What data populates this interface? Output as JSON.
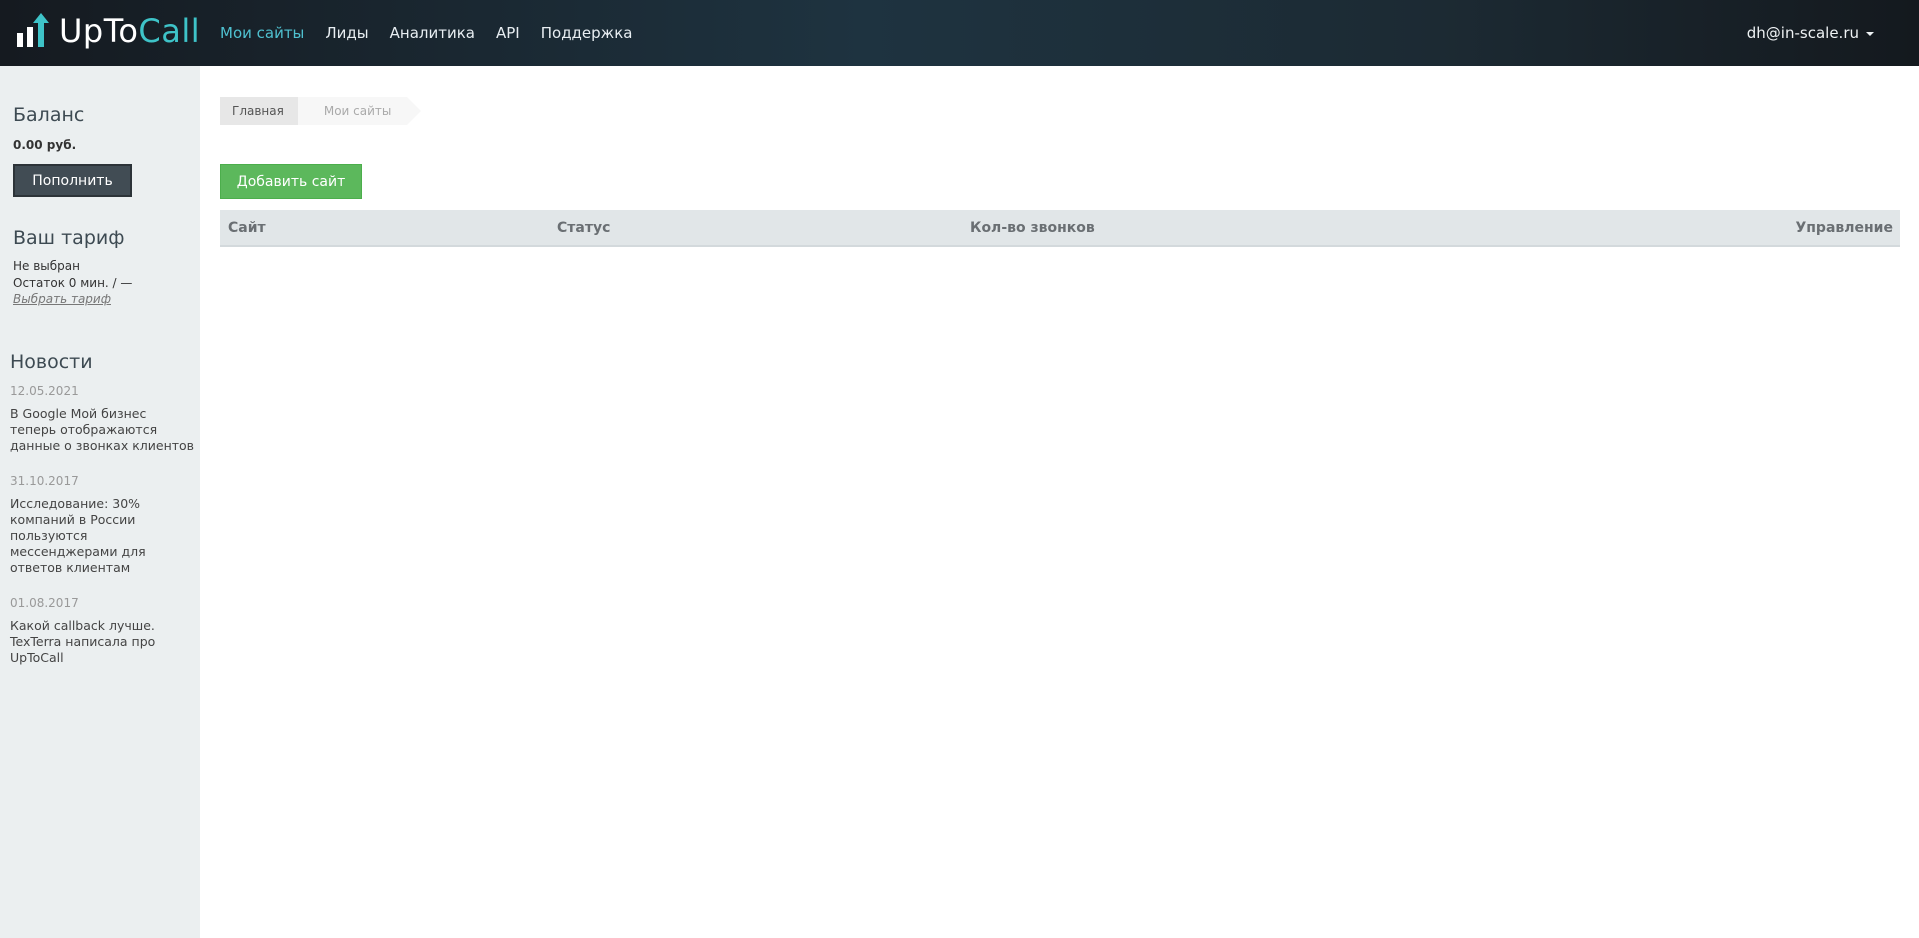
{
  "brand": {
    "name_part1": "UpTo",
    "name_part2": "Call",
    "accent_color": "#3ec3c8"
  },
  "nav": {
    "items": [
      {
        "label": "Мои сайты",
        "active": true
      },
      {
        "label": "Лиды",
        "active": false
      },
      {
        "label": "Аналитика",
        "active": false
      },
      {
        "label": "API",
        "active": false
      },
      {
        "label": "Поддержка",
        "active": false
      }
    ],
    "user_email": "dh@in-scale.ru",
    "user_icon": "caret-down-icon"
  },
  "sidebar": {
    "balance": {
      "title": "Баланс",
      "value": "0.00 руб.",
      "topup_label": "Пополнить"
    },
    "tariff": {
      "title": "Ваш тариф",
      "status": "Не выбран",
      "remaining": "Остаток 0 мин. / —",
      "choose_link": "Выбрать тариф"
    },
    "news": {
      "title": "Новости",
      "items": [
        {
          "date": "12.05.2021",
          "text": "В Google Мой бизнес теперь отображаются данные о звонках клиентов"
        },
        {
          "date": "31.10.2017",
          "text": "Исследование: 30% компаний в России пользуются мессенджерами для ответов клиентам"
        },
        {
          "date": "01.08.2017",
          "text": "Какой callback лучше. TexTerra написала про UpToCall"
        }
      ]
    }
  },
  "main": {
    "breadcrumb": {
      "home": "Главная",
      "current": "Мои сайты"
    },
    "add_site_label": "Добавить сайт",
    "add_site_color": "#5cb85c",
    "table": {
      "columns": [
        "Сайт",
        "Статус",
        "Кол-во звонков",
        "Управление"
      ],
      "rows": []
    }
  }
}
